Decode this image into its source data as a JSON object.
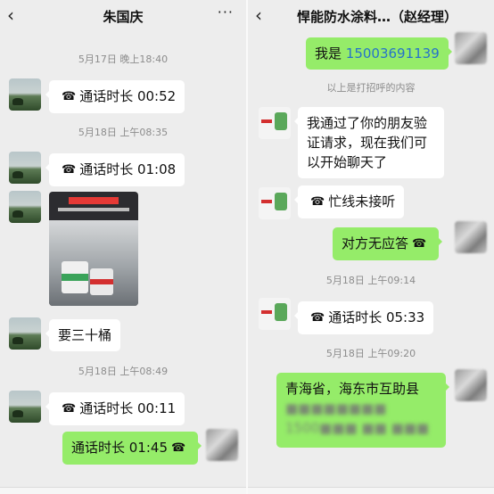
{
  "left": {
    "header": {
      "back_icon": "chevron-left-icon",
      "title": "朱国庆",
      "more_label": "···"
    },
    "messages": {
      "t1": "5月17日 晚上18:40",
      "call1": "通话时长 00:52",
      "t2": "5月18日 上午08:35",
      "call2": "通话时长 01:08",
      "text1": "要三十桶",
      "t3": "5月18日 上午08:49",
      "call3": "通话时长 00:11",
      "call4": "通话时长 01:45"
    }
  },
  "right": {
    "header": {
      "back_icon": "chevron-left-icon",
      "title": "悍能防水涂料…（赵经理）"
    },
    "messages": {
      "greeting_prefix": "我是 ",
      "greeting_phone": "15003691139",
      "notice": "以上是打招呼的内容",
      "verify": "我通过了你的朋友验证请求，现在我们可以开始聊天了",
      "busy": "忙线未接听",
      "no_answer": "对方无应答",
      "t1": "5月18日 上午09:14",
      "call1": "通话时长 05:33",
      "t2": "5月18日 上午09:20",
      "address_line1": "青海省，海东市互助县",
      "address_line2": "■■■■■■■■",
      "address_line3": "1500■■■ ■■ ■■■"
    }
  },
  "colors": {
    "sent_bubble": "#95ec69",
    "received_bubble": "#ffffff",
    "background": "#ededed",
    "link": "#2673c9"
  }
}
